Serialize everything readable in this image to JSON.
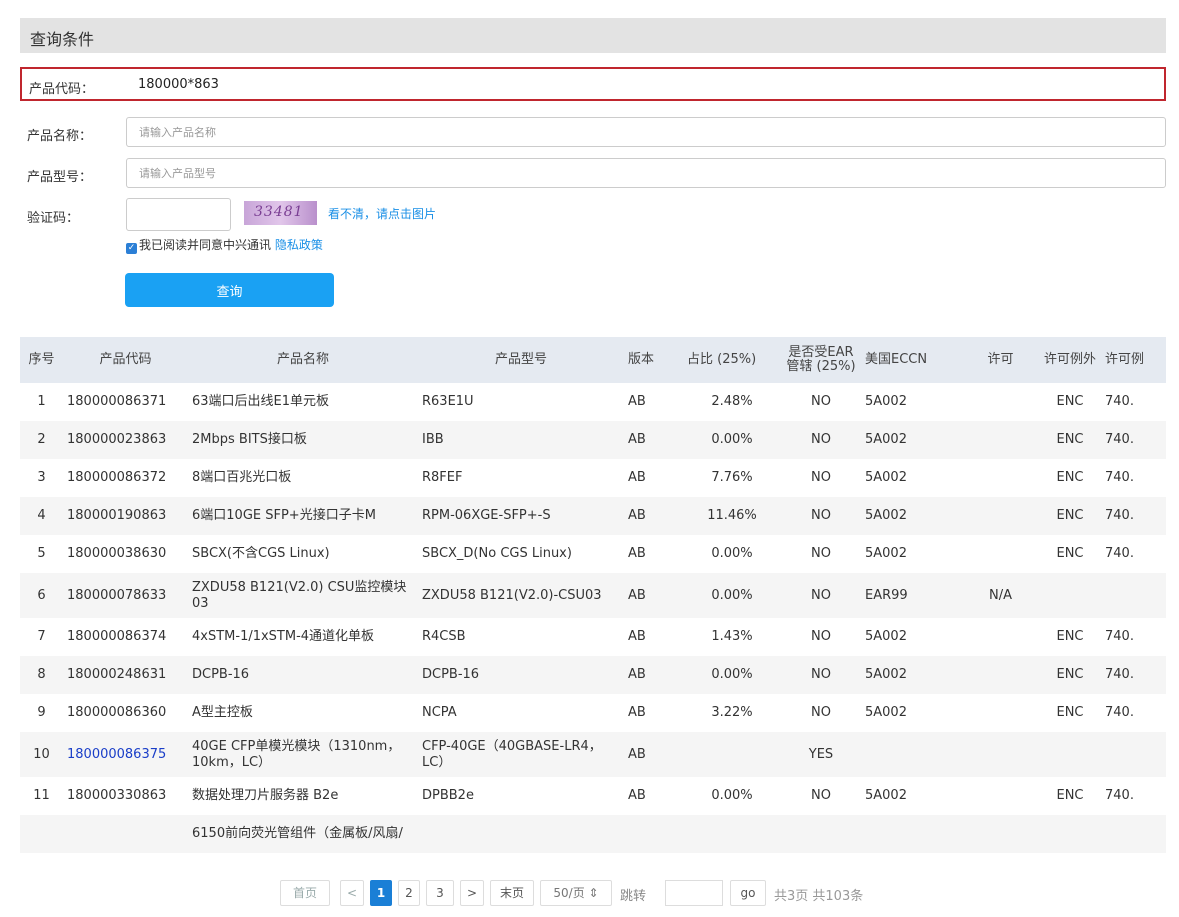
{
  "section_title": "查询条件",
  "form": {
    "product_code": {
      "label": "产品代码：",
      "value": "180000*863"
    },
    "product_name": {
      "label": "产品名称：",
      "placeholder": "请输入产品名称"
    },
    "product_model": {
      "label": "产品型号：",
      "placeholder": "请输入产品型号"
    },
    "captcha": {
      "label": "验证码：",
      "image_text": "33481",
      "refresh_link": "看不清，请点击图片"
    },
    "agree": {
      "text": "我已阅读并同意中兴通讯",
      "link": "隐私政策"
    },
    "query_button": "查询"
  },
  "table": {
    "headers": [
      "序号",
      "产品代码",
      "产品名称",
      "产品型号",
      "版本",
      "占比 (25%)",
      "是否受EAR管辖 (25%)",
      "美国ECCN",
      "许可",
      "许可例外",
      "许可例"
    ],
    "rows": [
      {
        "no": "1",
        "code": "180000086371",
        "name": "63端口后出线E1单元板",
        "model": "R63E1U",
        "ver": "AB",
        "ratio": "2.48%",
        "ear": "NO",
        "eccn": "5A002",
        "lic": "",
        "exc": "ENC",
        "lic2": "740."
      },
      {
        "no": "2",
        "code": "180000023863",
        "name": "2Mbps BITS接口板",
        "model": "IBB",
        "ver": "AB",
        "ratio": "0.00%",
        "ear": "NO",
        "eccn": "5A002",
        "lic": "",
        "exc": "ENC",
        "lic2": "740."
      },
      {
        "no": "3",
        "code": "180000086372",
        "name": "8端口百兆光口板",
        "model": "R8FEF",
        "ver": "AB",
        "ratio": "7.76%",
        "ear": "NO",
        "eccn": "5A002",
        "lic": "",
        "exc": "ENC",
        "lic2": "740."
      },
      {
        "no": "4",
        "code": "180000190863",
        "name": "6端口10GE SFP+光接口子卡M",
        "model": "RPM-06XGE-SFP+-S",
        "ver": "AB",
        "ratio": "11.46%",
        "ear": "NO",
        "eccn": "5A002",
        "lic": "",
        "exc": "ENC",
        "lic2": "740."
      },
      {
        "no": "5",
        "code": "180000038630",
        "name": "SBCX(不含CGS Linux)",
        "model": "SBCX_D(No CGS Linux)",
        "ver": "AB",
        "ratio": "0.00%",
        "ear": "NO",
        "eccn": "5A002",
        "lic": "",
        "exc": "ENC",
        "lic2": "740."
      },
      {
        "no": "6",
        "code": "180000078633",
        "name": "ZXDU58 B121(V2.0) CSU监控模块03",
        "model": "ZXDU58 B121(V2.0)-CSU03",
        "ver": "AB",
        "ratio": "0.00%",
        "ear": "NO",
        "eccn": "EAR99",
        "lic": "N/A",
        "exc": "",
        "lic2": ""
      },
      {
        "no": "7",
        "code": "180000086374",
        "name": "4xSTM-1/1xSTM-4通道化单板",
        "model": "R4CSB",
        "ver": "AB",
        "ratio": "1.43%",
        "ear": "NO",
        "eccn": "5A002",
        "lic": "",
        "exc": "ENC",
        "lic2": "740."
      },
      {
        "no": "8",
        "code": "180000248631",
        "name": "DCPB-16",
        "model": "DCPB-16",
        "ver": "AB",
        "ratio": "0.00%",
        "ear": "NO",
        "eccn": "5A002",
        "lic": "",
        "exc": "ENC",
        "lic2": "740."
      },
      {
        "no": "9",
        "code": "180000086360",
        "name": "A型主控板",
        "model": "NCPA",
        "ver": "AB",
        "ratio": "3.22%",
        "ear": "NO",
        "eccn": "5A002",
        "lic": "",
        "exc": "ENC",
        "lic2": "740."
      },
      {
        "no": "10",
        "code": "180000086375",
        "name": "40GE CFP单模光模块（1310nm，10km，LC）",
        "model": "CFP-40GE（40GBASE-LR4，LC）",
        "ver": "AB",
        "ratio": "",
        "ear": "YES",
        "eccn": "",
        "lic": "",
        "exc": "",
        "lic2": ""
      },
      {
        "no": "11",
        "code": "180000330863",
        "name": "数据处理刀片服务器 B2e",
        "model": "DPBB2e",
        "ver": "AB",
        "ratio": "0.00%",
        "ear": "NO",
        "eccn": "5A002",
        "lic": "",
        "exc": "ENC",
        "lic2": "740."
      },
      {
        "no": "",
        "code": "",
        "name": "6150前向荧光管组件（金属板/风扇/",
        "model": "",
        "ver": "",
        "ratio": "",
        "ear": "",
        "eccn": "",
        "lic": "",
        "exc": "",
        "lic2": ""
      }
    ]
  },
  "pagination": {
    "first": "首页",
    "prev": "<",
    "pages": [
      "1",
      "2",
      "3"
    ],
    "next": ">",
    "last": "末页",
    "page_size": "50/页 ⇕",
    "jump_label": "跳转",
    "go": "go",
    "summary": "共3页 共103条"
  }
}
